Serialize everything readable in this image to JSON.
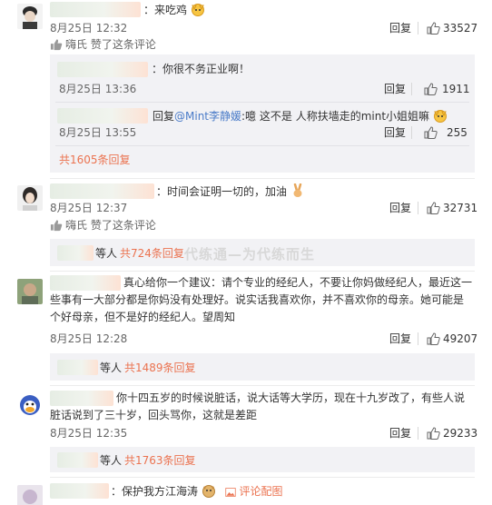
{
  "comments": [
    {
      "text": "：来吃鸡",
      "time": "8月25日 12:32",
      "reply": "回复",
      "likes": "33527",
      "liked_by": "嗨氏 赞了这条评论",
      "sub_replies": [
        {
          "text": "：你很不务正业啊！",
          "time": "8月25日 13:36",
          "reply": "回复",
          "likes": "1911"
        },
        {
          "prefix": "回复",
          "mention": "@Mint李静媛",
          "text": ":噫 这不是 人称扶墙走的mint小姐姐嘛",
          "time": "8月25日 13:55",
          "reply": "回复",
          "likes": "255"
        }
      ],
      "more": "共1605条回复"
    },
    {
      "text": "：时间会证明一切的，加油",
      "time": "8月25日 12:37",
      "reply": "回复",
      "likes": "32731",
      "liked_by": "嗨氏 赞了这条评论",
      "more_prefix": "等人",
      "more": "共724条回复"
    },
    {
      "text_line1": "真心给你一个建议：请个专业的经纪人，不要让你妈做经纪人，最近这一",
      "text_line2": "些事有一大部分都是你妈没有处理好。说实话我喜欢你，并不喜欢你的母亲。她可能是",
      "text_line3": "个好母亲，但不是好的经纪人。望周知",
      "time": "8月25日 12:28",
      "reply": "回复",
      "likes": "49207",
      "more_prefix": "等人",
      "more": "共1489条回复"
    },
    {
      "text_line1": "你十四五岁的时候说脏话，说大话等大学历，现在十九岁改了，有些人说",
      "text_line2": "脏话说到了三十岁，回头骂你，这就是差距",
      "time": "8月25日 12:35",
      "reply": "回复",
      "likes": "29233",
      "more_prefix": "等人",
      "more": "共1763条回复"
    },
    {
      "text": "：保护我方江海涛",
      "pic_label": "评论配图"
    }
  ],
  "watermark": "代练通—为代练而生",
  "colors": {
    "link": "#eb7350",
    "mention": "#4a7bc8",
    "reply_bg": "#f2f2f5"
  }
}
